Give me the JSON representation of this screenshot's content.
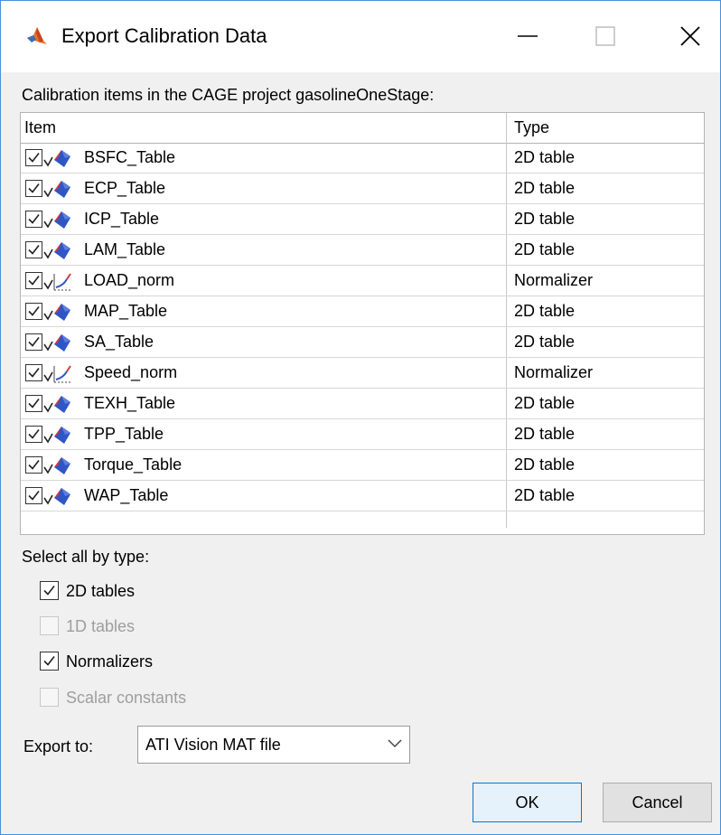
{
  "window": {
    "title": "Export Calibration Data",
    "icon": "matlab-icon",
    "controls": [
      "minimize-icon",
      "maximize-icon",
      "close-icon"
    ]
  },
  "caption": "Calibration items in the CAGE project gasolineOneStage:",
  "table": {
    "headers": {
      "item": "Item",
      "type": "Type"
    },
    "rows": [
      {
        "name": "BSFC_Table",
        "type": "2D table",
        "icon": "table-icon",
        "checked": true
      },
      {
        "name": "ECP_Table",
        "type": "2D table",
        "icon": "table-icon",
        "checked": true
      },
      {
        "name": "ICP_Table",
        "type": "2D table",
        "icon": "table-icon",
        "checked": true
      },
      {
        "name": "LAM_Table",
        "type": "2D table",
        "icon": "table-icon",
        "checked": true
      },
      {
        "name": "LOAD_norm",
        "type": "Normalizer",
        "icon": "normalizer-icon",
        "checked": true
      },
      {
        "name": "MAP_Table",
        "type": "2D table",
        "icon": "table-icon",
        "checked": true
      },
      {
        "name": "SA_Table",
        "type": "2D table",
        "icon": "table-icon",
        "checked": true
      },
      {
        "name": "Speed_norm",
        "type": "Normalizer",
        "icon": "normalizer-icon",
        "checked": true
      },
      {
        "name": "TEXH_Table",
        "type": "2D table",
        "icon": "table-icon",
        "checked": true
      },
      {
        "name": "TPP_Table",
        "type": "2D table",
        "icon": "table-icon",
        "checked": true
      },
      {
        "name": "Torque_Table",
        "type": "2D table",
        "icon": "table-icon",
        "checked": true
      },
      {
        "name": "WAP_Table",
        "type": "2D table",
        "icon": "table-icon",
        "checked": true
      }
    ]
  },
  "select_by_type": {
    "label": "Select all by type:",
    "options": [
      {
        "label": "2D tables",
        "checked": true,
        "enabled": true
      },
      {
        "label": "1D tables",
        "checked": false,
        "enabled": false
      },
      {
        "label": "Normalizers",
        "checked": true,
        "enabled": true
      },
      {
        "label": "Scalar constants",
        "checked": false,
        "enabled": false
      }
    ]
  },
  "export": {
    "label": "Export to:",
    "value": "ATI Vision MAT file"
  },
  "buttons": {
    "ok": "OK",
    "cancel": "Cancel"
  },
  "colors": {
    "accent": "#0078d7",
    "window_border": "#4a90d9",
    "dialog_bg": "#f0f0f0"
  }
}
